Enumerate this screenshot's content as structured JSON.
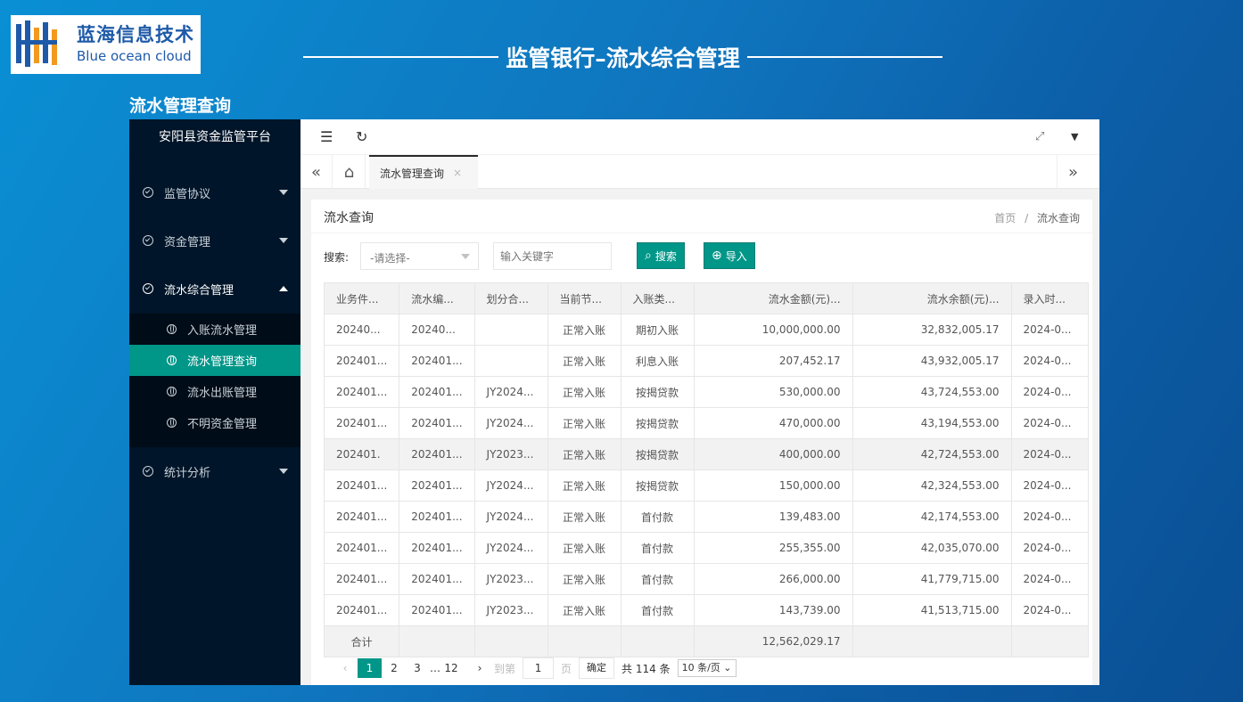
{
  "logo": {
    "cn": "蓝海信息技术",
    "en": "Blue ocean cloud"
  },
  "banner": {
    "title": "监管银行–流水综合管理"
  },
  "section": {
    "title": "流水管理查询"
  },
  "sidebar": {
    "title": "安阳县资金监管平台",
    "menus": [
      {
        "label": "监管协议",
        "expanded": false
      },
      {
        "label": "资金管理",
        "expanded": false
      },
      {
        "label": "流水综合管理",
        "expanded": true
      },
      {
        "label": "统计分析",
        "expanded": false
      }
    ],
    "subitems": [
      {
        "label": "入账流水管理",
        "active": false
      },
      {
        "label": "流水管理查询",
        "active": true
      },
      {
        "label": "流水出账管理",
        "active": false
      },
      {
        "label": "不明资金管理",
        "active": false
      }
    ]
  },
  "tabs": {
    "active_label": "流水管理查询",
    "close": "×"
  },
  "card": {
    "title": "流水查询",
    "breadcrumb": {
      "home": "首页",
      "sep": "/",
      "current": "流水查询"
    }
  },
  "filters": {
    "search_label": "搜索:",
    "select_value": "-请选择-",
    "keyword_placeholder": "输入关键字",
    "search_button": "搜索",
    "import_button": "导入"
  },
  "table": {
    "columns": [
      "业务件...",
      "流水编...",
      "划分合...",
      "当前节...",
      "入账类...",
      "流水金额(元)...",
      "流水余额(元)...",
      "录入时..."
    ],
    "rows": [
      [
        "20240...",
        "20240...",
        "",
        "正常入账",
        "期初入账",
        "10,000,000.00",
        "32,832,005.17",
        "2024-0..."
      ],
      [
        "202401...",
        "202401...",
        "",
        "正常入账",
        "利息入账",
        "207,452.17",
        "43,932,005.17",
        "2024-0..."
      ],
      [
        "202401...",
        "202401...",
        "JY2024...",
        "正常入账",
        "按揭贷款",
        "530,000.00",
        "43,724,553.00",
        "2024-0..."
      ],
      [
        "202401...",
        "202401...",
        "JY2024...",
        "正常入账",
        "按揭贷款",
        "470,000.00",
        "43,194,553.00",
        "2024-0..."
      ],
      [
        "202401.",
        "202401...",
        "JY2023...",
        "正常入账",
        "按揭贷款",
        "400,000.00",
        "42,724,553.00",
        "2024-0..."
      ],
      [
        "202401...",
        "202401...",
        "JY2024...",
        "正常入账",
        "按揭贷款",
        "150,000.00",
        "42,324,553.00",
        "2024-0..."
      ],
      [
        "202401...",
        "202401...",
        "JY2024...",
        "正常入账",
        "首付款",
        "139,483.00",
        "42,174,553.00",
        "2024-0..."
      ],
      [
        "202401...",
        "202401...",
        "JY2024...",
        "正常入账",
        "首付款",
        "255,355.00",
        "42,035,070.00",
        "2024-0..."
      ],
      [
        "202401...",
        "202401...",
        "JY2023...",
        "正常入账",
        "首付款",
        "266,000.00",
        "41,779,715.00",
        "2024-0..."
      ],
      [
        "202401...",
        "202401...",
        "JY2023...",
        "正常入账",
        "首付款",
        "143,739.00",
        "41,513,715.00",
        "2024-0..."
      ]
    ],
    "total_label": "合计",
    "total_amount": "12,562,029.17"
  },
  "pager": {
    "prev": "‹",
    "next": "›",
    "pages": [
      "1",
      "2",
      "3"
    ],
    "ellipsis": "…",
    "last": "12",
    "goto_label": "到第",
    "goto_value": "1",
    "page_unit": "页",
    "confirm": "确定",
    "total": "共 114 条",
    "page_size": "10 条/页"
  }
}
